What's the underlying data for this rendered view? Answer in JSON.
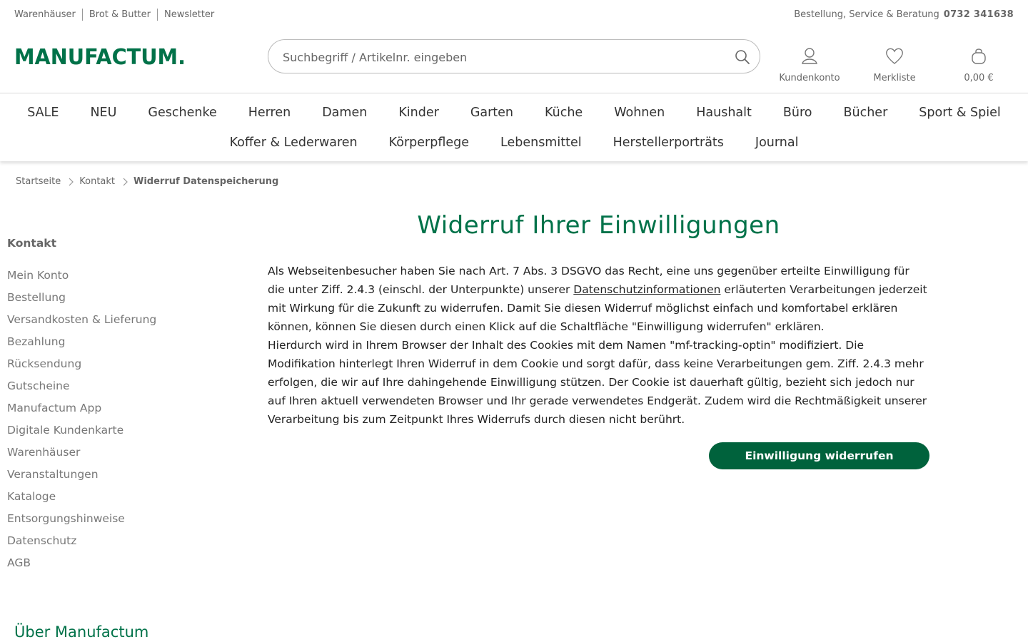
{
  "topbar": {
    "links": [
      "Warenhäuser",
      "Brot & Butter",
      "Newsletter"
    ],
    "service_label": "Bestellung, Service & Beratung",
    "phone": "0732 341638"
  },
  "brand": {
    "logo_text": "MANUFACTUM.",
    "color": "#007249"
  },
  "search": {
    "placeholder": "Suchbegriff / Artikelnr. eingeben",
    "value": "",
    "icon": "search-icon"
  },
  "header_actions": [
    {
      "label": "Kundenkonto",
      "icon": "user-icon"
    },
    {
      "label": "Merkliste",
      "icon": "heart-icon"
    },
    {
      "label": "0,00 €",
      "icon": "shopping-bag-icon"
    }
  ],
  "nav": {
    "row1": [
      "SALE",
      "NEU",
      "Geschenke",
      "Herren",
      "Damen",
      "Kinder",
      "Garten",
      "Küche",
      "Wohnen",
      "Haushalt",
      "Büro",
      "Bücher",
      "Sport & Spiel"
    ],
    "row2": [
      "Koffer & Lederwaren",
      "Körperpflege",
      "Lebensmittel",
      "Herstellerporträts",
      "Journal"
    ]
  },
  "breadcrumb": {
    "items": [
      "Startseite",
      "Kontakt"
    ],
    "current": "Widerruf Datenspeicherung"
  },
  "sidebar": {
    "title": "Kontakt",
    "items": [
      "Mein Konto",
      "Bestellung",
      "Versandkosten & Lieferung",
      "Bezahlung",
      "Rücksendung",
      "Gutscheine",
      "Manufactum App",
      "Digitale Kundenkarte",
      "Warenhäuser",
      "Veranstaltungen",
      "Kataloge",
      "Entsorgungshinweise",
      "Datenschutz",
      "AGB"
    ]
  },
  "main": {
    "title": "Widerruf Ihrer Einwilligungen",
    "para1_before": "Als Webseitenbesucher haben Sie nach Art. 7 Abs. 3 DSGVO das Recht, eine uns gegenüber erteilte Einwilligung für die unter Ziff. 2.4.3 (einschl. der Unterpunkte) unserer ",
    "para1_link": "Datenschutzinformationen",
    "para1_after": " erläuterten Verarbeitungen jederzeit mit Wirkung für die Zukunft zu widerrufen. Damit Sie diesen Widerruf möglichst einfach und komfortabel erklären können, können Sie diesen durch einen Klick auf die Schaltfläche \"Einwilligung widerrufen\" erklären.",
    "para2": "Hierdurch wird in Ihrem Browser der Inhalt des Cookies mit dem Namen \"mf-tracking-optin\" modifiziert. Die Modifikation hinterlegt Ihren Widerruf in dem Cookie und sorgt dafür, dass keine Verarbeitungen gem. Ziff. 2.4.3 mehr erfolgen, die wir auf Ihre dahingehende Einwilligung stützen. Der Cookie ist dauerhaft gültig, bezieht sich jedoch nur auf Ihren aktuell verwendeten Browser und Ihr gerade verwendetes Endgerät. Zudem wird die Rechtmäßigkeit unserer Verarbeitung bis zum Zeitpunkt Ihres Widerrufs durch diesen nicht berührt.",
    "button_label": "Einwilligung widerrufen",
    "button_color": "#00623c"
  },
  "footer": {
    "about_title": "Über Manufactum"
  }
}
